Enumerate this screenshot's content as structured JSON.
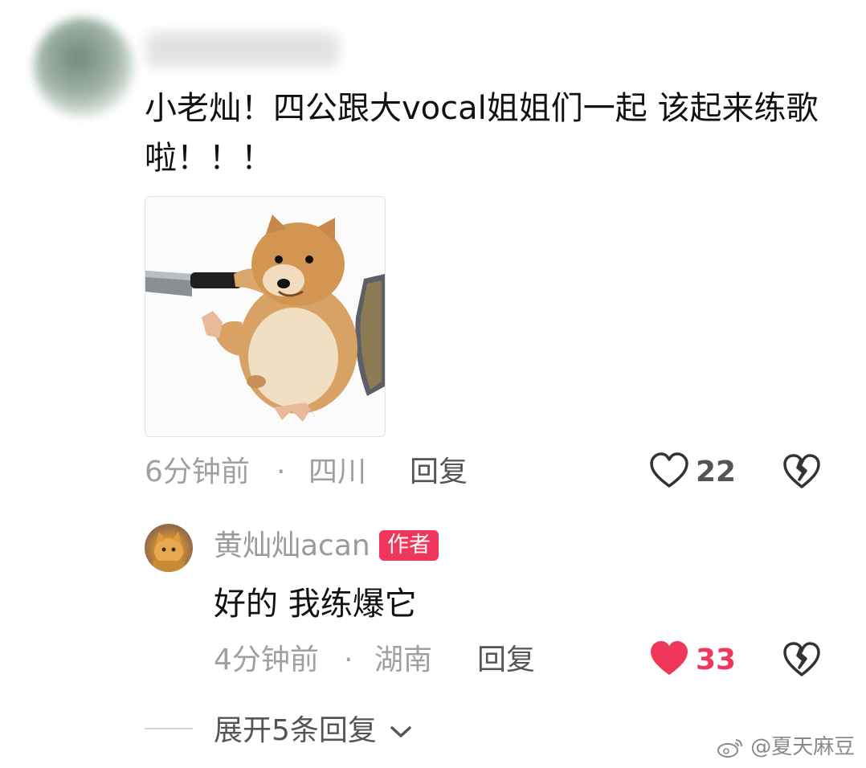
{
  "comment": {
    "text": "小老灿！四公跟大vocal姐姐们一起 该起来练歌啦！！！",
    "time": "6分钟前",
    "dot": "·",
    "location": "四川",
    "reply_label": "回复",
    "likes": "22"
  },
  "reply": {
    "username": "黄灿灿acan",
    "badge": "作者",
    "text": "好的 我练爆它",
    "time": "4分钟前",
    "dot": "·",
    "location": "湖南",
    "reply_label": "回复",
    "likes": "33"
  },
  "expand": {
    "label": "展开5条回复"
  },
  "watermark": "@夏天麻豆",
  "icons": {
    "like_outline": "heart-outline-icon",
    "like_filled": "heart-filled-icon",
    "dislike": "broken-heart-icon",
    "chevron": "chevron-down-icon",
    "weibo": "weibo-logo-icon"
  },
  "colors": {
    "like_active": "#f0365a",
    "badge": "#f0365a",
    "meta": "#a0a0a0"
  }
}
